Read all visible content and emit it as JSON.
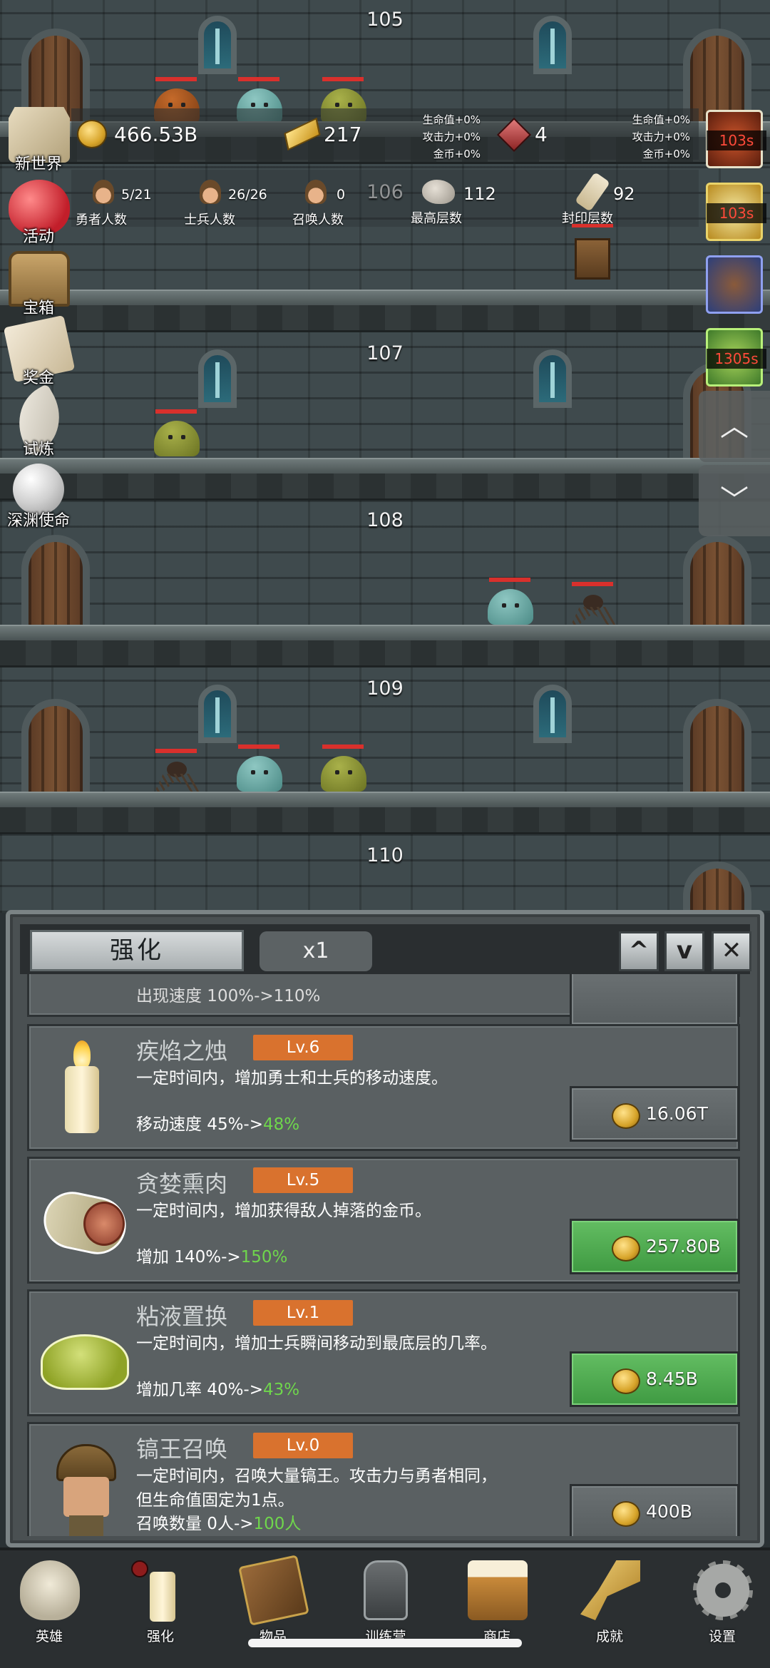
{
  "floors": [
    {
      "num": "105"
    },
    {
      "num": "106"
    },
    {
      "num": "107"
    },
    {
      "num": "108"
    },
    {
      "num": "109"
    },
    {
      "num": "110"
    }
  ],
  "hud": {
    "gold": "466.53B",
    "gold_bars": "217",
    "gems": "4",
    "buffs_left": [
      "生命值+0%",
      "攻击力+0%",
      "金币+0%"
    ],
    "buffs_right": [
      "生命值+0%",
      "攻击力+0%",
      "金币+0%"
    ],
    "heroes_value": "5/21",
    "heroes_label": "勇者人数",
    "soldiers_value": "26/26",
    "soldiers_label": "士兵人数",
    "summon_value": "0",
    "summon_label": "召唤人数",
    "max_floor_value": "112",
    "max_floor_label": "最高层数",
    "seal_floor_value": "92",
    "seal_floor_label": "封印层数"
  },
  "side_menu": [
    {
      "label": "新世界"
    },
    {
      "label": "活动"
    },
    {
      "label": "宝箱"
    },
    {
      "label": "奖金"
    },
    {
      "label": "试炼"
    },
    {
      "label": "深渊使命"
    }
  ],
  "buff_timers": [
    "103s",
    "103s",
    "",
    "1305s"
  ],
  "panel": {
    "tab_title": "强化",
    "multiplier": "x1",
    "up_icon": "chevron-up-icon",
    "down_icon": "chevron-down-icon",
    "close_icon": "close-icon",
    "partial_top_text": "出现速度 100%->110%",
    "items": [
      {
        "name": "疾焰之烛",
        "level": "Lv.6",
        "desc1": "一定时间内，增加勇士和士兵的移动速度。",
        "desc2": "",
        "stat_label": "移动速度 45%->",
        "stat_new": "48%",
        "price": "16.06T",
        "affordable": false
      },
      {
        "name": "贪婪熏肉",
        "level": "Lv.5",
        "desc1": "一定时间内，增加获得敌人掉落的金币。",
        "desc2": "",
        "stat_label": "增加 140%->",
        "stat_new": "150%",
        "price": "257.80B",
        "affordable": true
      },
      {
        "name": "粘液置换",
        "level": "Lv.1",
        "desc1": "一定时间内，增加士兵瞬间移动到最底层的几率。",
        "desc2": "",
        "stat_label": "增加几率 40%->",
        "stat_new": "43%",
        "price": "8.45B",
        "affordable": true
      },
      {
        "name": "镐王召唤",
        "level": "Lv.0",
        "desc1": "一定时间内，召唤大量镐王。攻击力与勇者相同，",
        "desc2": "但生命值固定为1点。",
        "stat_label": "召唤数量 0人->",
        "stat_new": "100人",
        "price": "400B",
        "affordable": false
      }
    ]
  },
  "bottom_nav": [
    {
      "label": "英雄",
      "icon": "skull-icon"
    },
    {
      "label": "强化",
      "icon": "candle-icon"
    },
    {
      "label": "物品",
      "icon": "book-icon"
    },
    {
      "label": "训练营",
      "icon": "lantern-icon"
    },
    {
      "label": "商店",
      "icon": "beer-mug-icon"
    },
    {
      "label": "成就",
      "icon": "key-icon"
    },
    {
      "label": "设置",
      "icon": "gear-icon"
    }
  ],
  "colors": {
    "accent_green": "#6fd64c",
    "level_badge": "#d9722e",
    "buy_green": "#4caf50",
    "timer_red": "#ff4a3a"
  }
}
